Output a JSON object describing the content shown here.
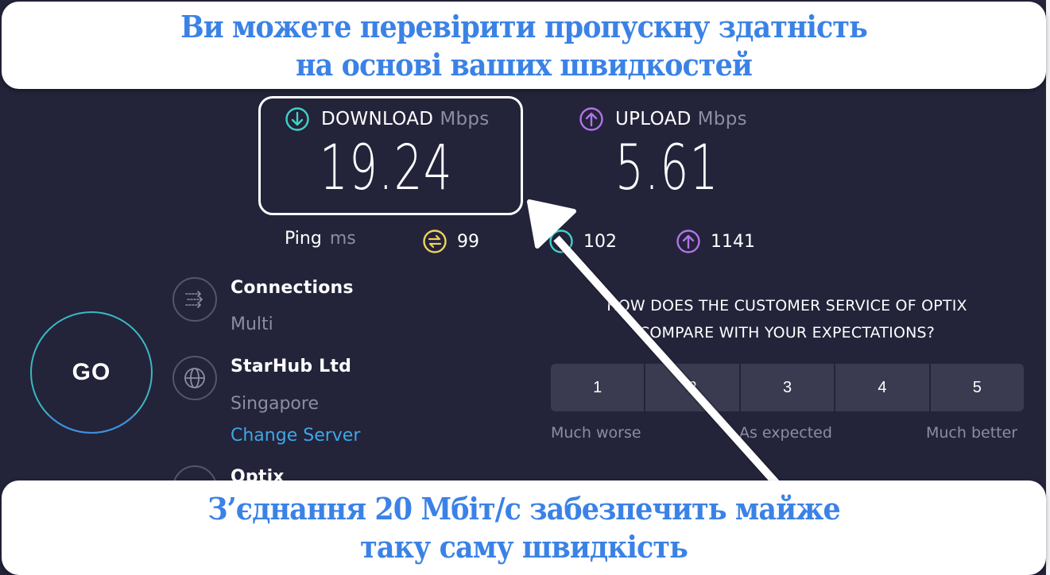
{
  "banners": {
    "top": [
      "Ви можете перевірити пропускну здатність",
      "на основі ваших швидкостей"
    ],
    "bottom": [
      "З’єднання 20 Мбіт/с забезпечить майже",
      "таку саму швидкість"
    ]
  },
  "results": {
    "download": {
      "label": "DOWNLOAD",
      "unit": "Mbps",
      "value": "19.24",
      "icon": "download-arrow-icon",
      "color": "#3fd3c8"
    },
    "upload": {
      "label": "UPLOAD",
      "unit": "Mbps",
      "value": "5.61",
      "icon": "upload-arrow-icon",
      "color": "#b373e8"
    }
  },
  "ping": {
    "label": "Ping",
    "unit": "ms",
    "idle": {
      "value": "99",
      "color": "#f0d25a"
    },
    "download": {
      "value": "102",
      "color": "#3fd3c8"
    },
    "upload": {
      "value": "1141",
      "color": "#b373e8"
    }
  },
  "go_button": {
    "label": "GO"
  },
  "info": {
    "connections": {
      "title": "Connections",
      "value": "Multi"
    },
    "server": {
      "title": "StarHub Ltd",
      "location": "Singapore",
      "change_link": "Change Server"
    },
    "provider": {
      "title": "Optix"
    }
  },
  "survey": {
    "question_line1": "HOW DOES THE CUSTOMER SERVICE OF OPTIX",
    "question_line2": "COMPARE WITH YOUR EXPECTATIONS?",
    "options": [
      "1",
      "2",
      "3",
      "4",
      "5"
    ],
    "labels": {
      "low": "Much worse",
      "mid": "As expected",
      "high": "Much better"
    }
  },
  "colors": {
    "background": "#23233a",
    "banner_text": "#3b82e6",
    "link": "#3ea7e6",
    "muted": "#8d8ca3"
  }
}
